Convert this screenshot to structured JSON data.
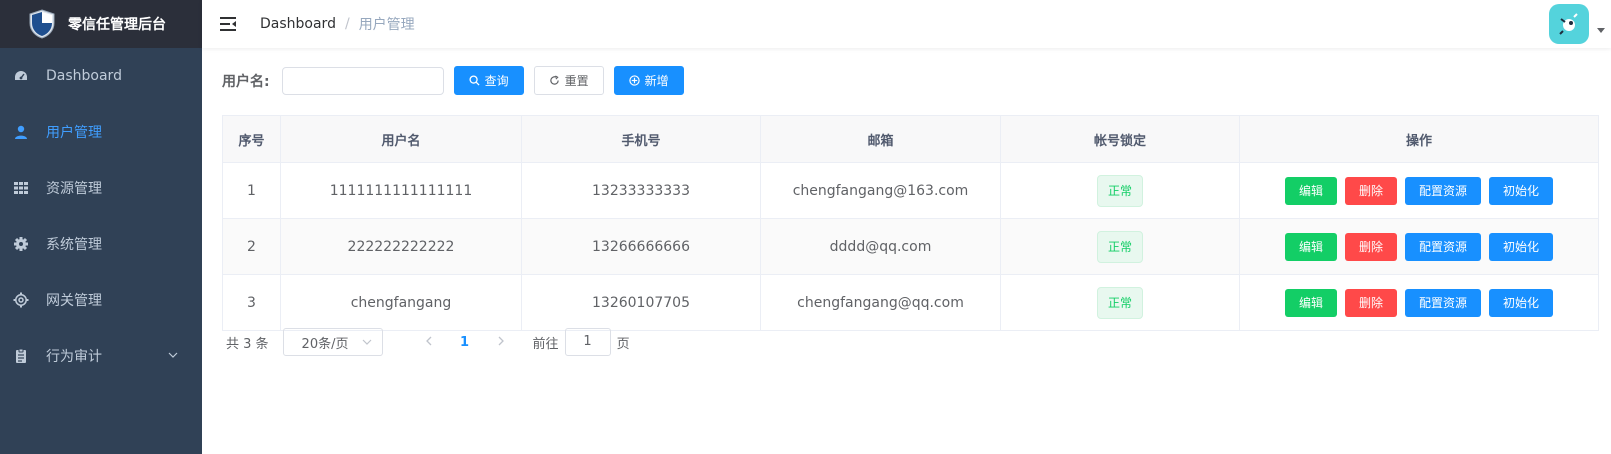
{
  "app": {
    "title": "零信任管理后台"
  },
  "sidebar": {
    "items": [
      {
        "label": "Dashboard",
        "icon": "dashboard-icon"
      },
      {
        "label": "用户管理",
        "icon": "user-icon",
        "active": true
      },
      {
        "label": "资源管理",
        "icon": "grid-icon"
      },
      {
        "label": "系统管理",
        "icon": "gear-icon"
      },
      {
        "label": "网关管理",
        "icon": "gear-outline-icon"
      },
      {
        "label": "行为审计",
        "icon": "clipboard-icon",
        "expandable": true
      }
    ]
  },
  "header": {
    "breadcrumb": [
      "Dashboard",
      "用户管理"
    ],
    "separator": "/"
  },
  "filter": {
    "username_label": "用户名:",
    "username_value": "",
    "search_label": "查询",
    "reset_label": "重置",
    "add_label": "新增"
  },
  "table": {
    "columns": [
      "序号",
      "用户名",
      "手机号",
      "邮箱",
      "帐号锁定",
      "操作"
    ],
    "rows": [
      {
        "index": "1",
        "username": "1111111111111111",
        "phone": "13233333333",
        "email": "chengfangang@163.com",
        "status": "正常"
      },
      {
        "index": "2",
        "username": "222222222222",
        "phone": "13266666666",
        "email": "dddd@qq.com",
        "status": "正常"
      },
      {
        "index": "3",
        "username": "chengfangang",
        "phone": "13260107705",
        "email": "chengfangang@qq.com",
        "status": "正常"
      }
    ],
    "actions": {
      "edit": "编辑",
      "delete": "删除",
      "config": "配置资源",
      "init": "初始化"
    }
  },
  "pagination": {
    "total": "共 3 条",
    "page_size": "20条/页",
    "current": "1",
    "goto_prefix": "前往",
    "goto_value": "1",
    "goto_suffix": "页"
  },
  "colors": {
    "sidebar_bg": "#304156",
    "logo_bg": "#2b2f3a",
    "primary": "#1890ff",
    "success": "#13ce66",
    "danger": "#ff4949",
    "active_menu": "#409eff"
  }
}
